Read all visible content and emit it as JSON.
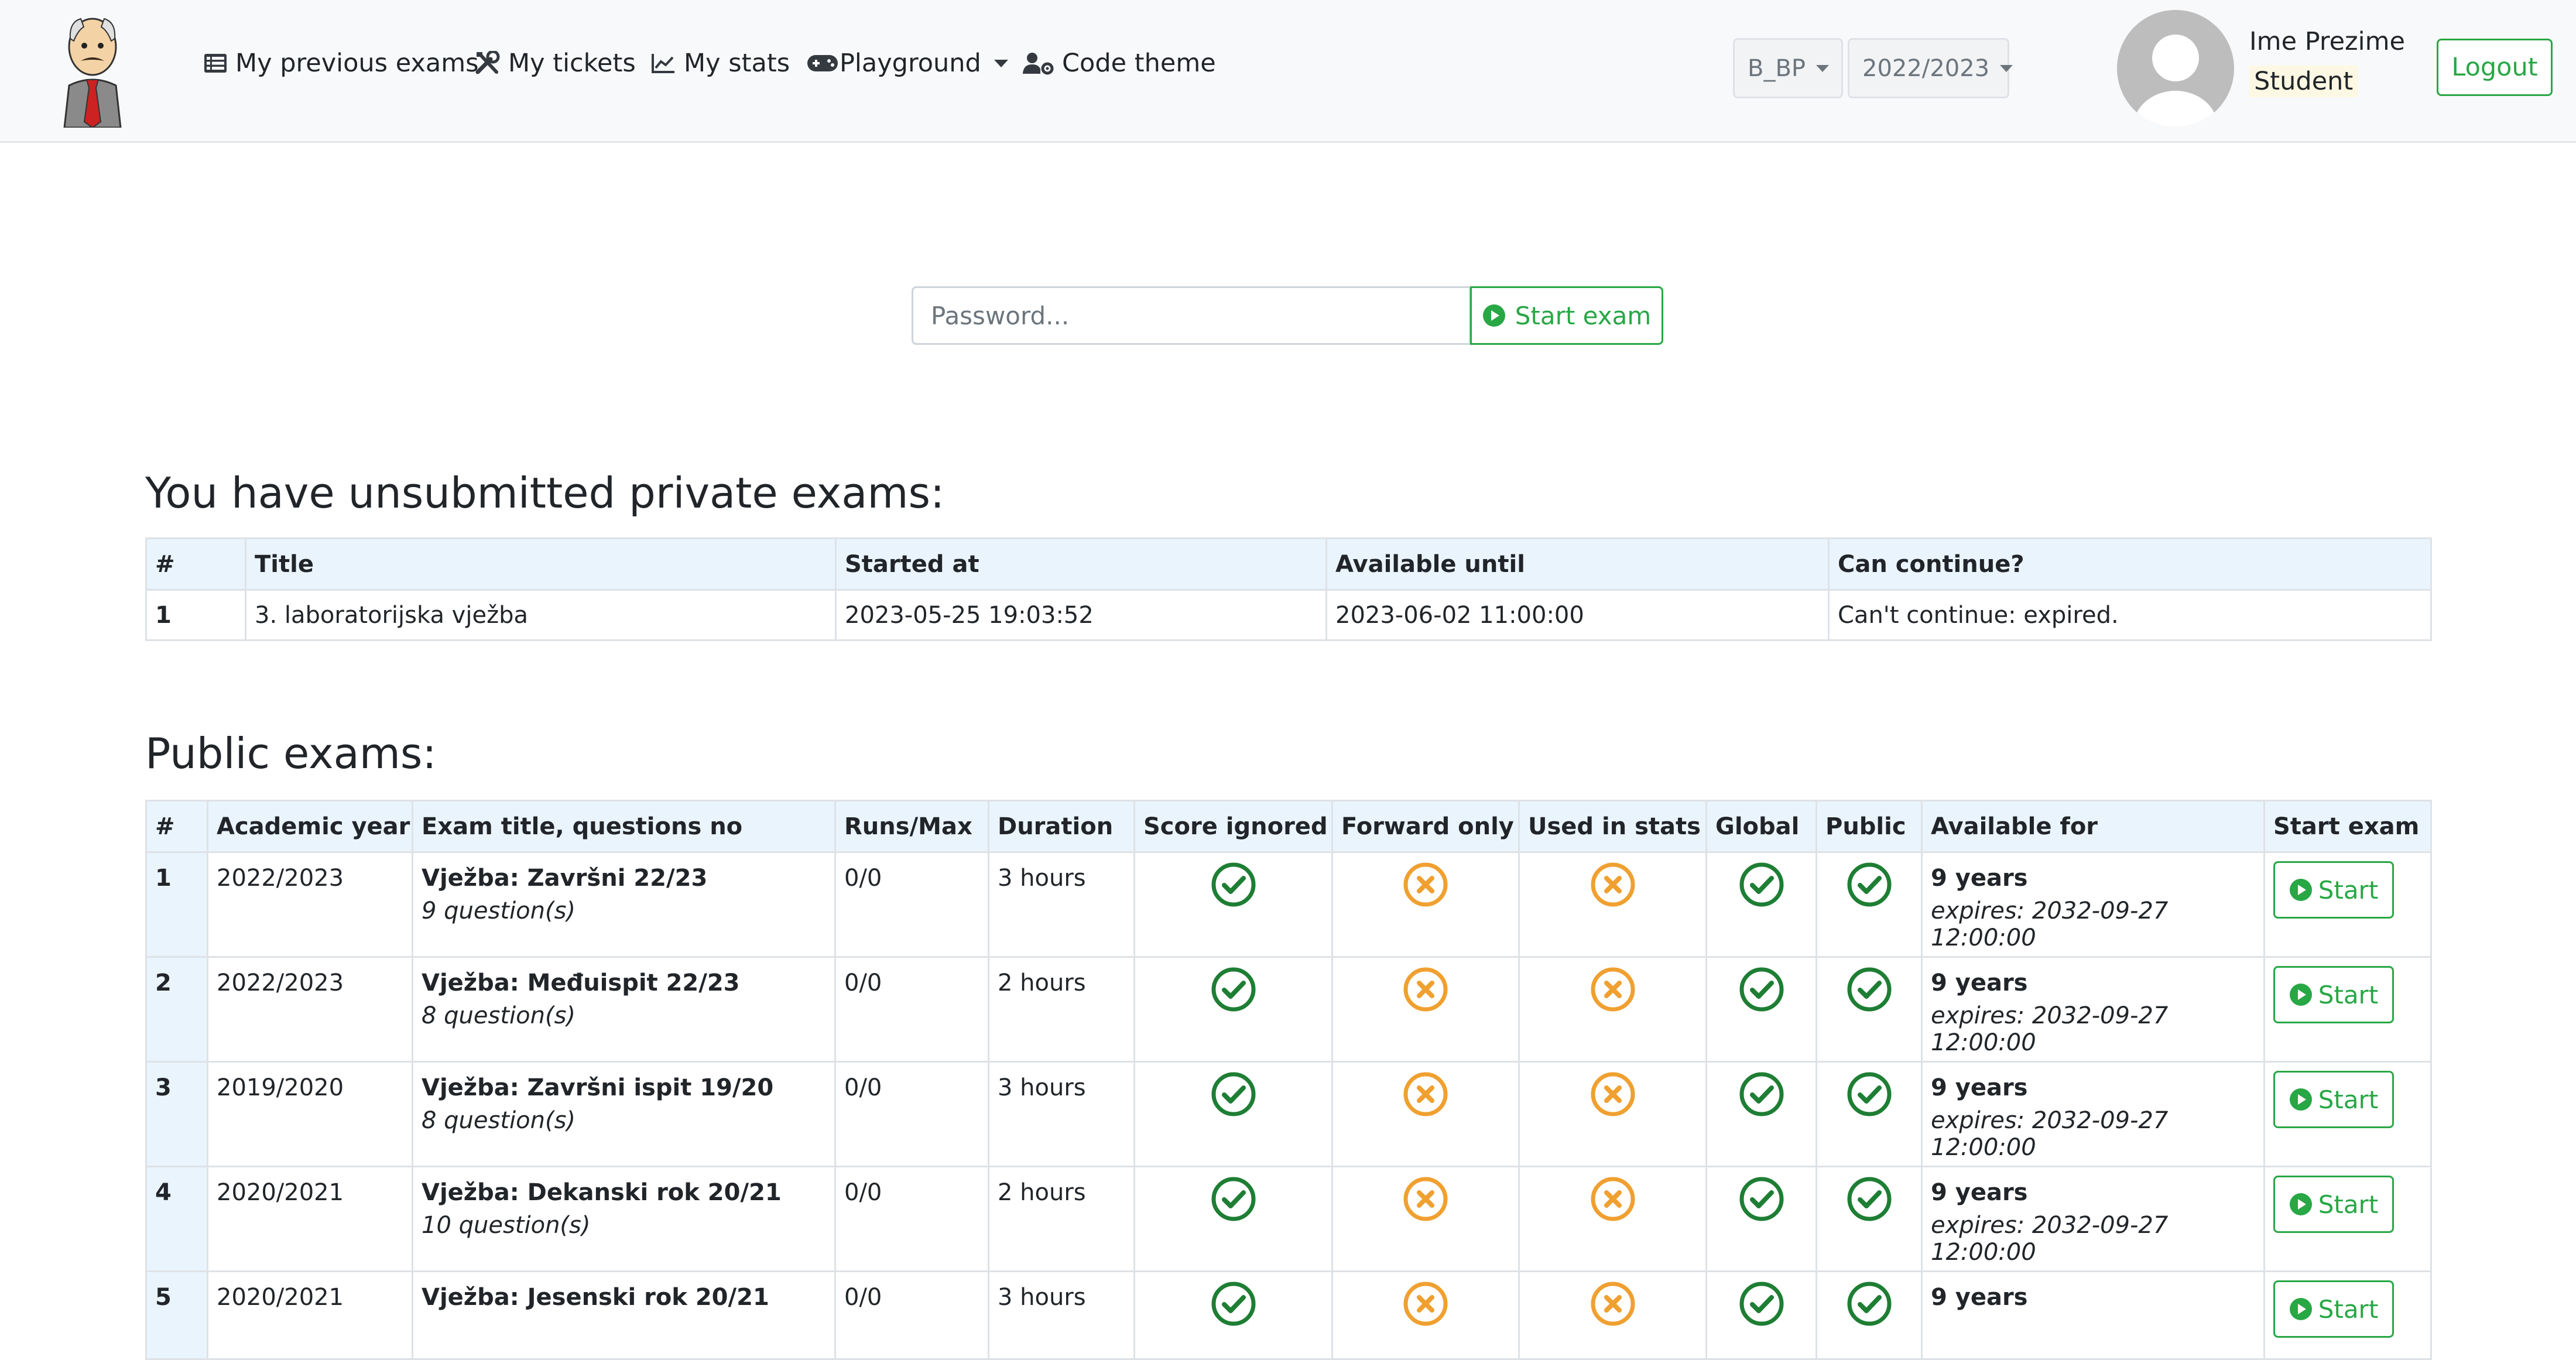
{
  "navbar": {
    "logo_icon": "professor-logo-icon",
    "items": [
      {
        "label": "My previous exams",
        "icon": "list-icon"
      },
      {
        "label": "My tickets",
        "icon": "tools-icon"
      },
      {
        "label": "My stats",
        "icon": "chart-line-icon"
      },
      {
        "label": "Playground",
        "icon": "gamepad-icon"
      },
      {
        "label": "Code theme",
        "icon": "user-cog-icon"
      }
    ],
    "course_select": "B_BP",
    "year_select": "2022/2023",
    "user": {
      "name": "Ime Prezime",
      "role": "Student"
    },
    "logout_label": "Logout"
  },
  "exam_form": {
    "password_placeholder": "Password...",
    "start_label": "Start exam"
  },
  "private_exams": {
    "title": "You have unsubmitted private exams:",
    "columns": [
      "#",
      "Title",
      "Started at",
      "Available until",
      "Can continue?"
    ],
    "rows": [
      [
        "1",
        "3. laboratorijska vježba",
        "2023-05-25 19:03:52",
        "2023-06-02 11:00:00",
        "Can't continue: expired."
      ]
    ]
  },
  "public_exams": {
    "title": "Public exams:",
    "columns": [
      "#",
      "Academic year",
      "Exam title, questions no",
      "Runs/Max",
      "Duration",
      "Score ignored",
      "Forward only",
      "Used in stats",
      "Global",
      "Public",
      "Available for",
      "Start exam"
    ],
    "rows": [
      {
        "num": "1",
        "year": "2022/2023",
        "title": "Vježba: Završni 22/23",
        "questions": "9 question(s)",
        "runs": "0/0",
        "duration": "3 hours",
        "available": "9 years",
        "expires": "expires: 2032-09-27 12:00:00",
        "start": "Start"
      },
      {
        "num": "2",
        "year": "2022/2023",
        "title": "Vježba: Međuispit 22/23",
        "questions": "8 question(s)",
        "runs": "0/0",
        "duration": "2 hours",
        "available": "9 years",
        "expires": "expires: 2032-09-27 12:00:00",
        "start": "Start"
      },
      {
        "num": "3",
        "year": "2019/2020",
        "title": "Vježba: Završni ispit 19/20",
        "questions": "8 question(s)",
        "runs": "0/0",
        "duration": "3 hours",
        "available": "9 years",
        "expires": "expires: 2032-09-27 12:00:00",
        "start": "Start"
      },
      {
        "num": "4",
        "year": "2020/2021",
        "title": "Vježba: Dekanski rok 20/21",
        "questions": "10 question(s)",
        "runs": "0/0",
        "duration": "2 hours",
        "available": "9 years",
        "expires": "expires: 2032-09-27 12:00:00",
        "start": "Start"
      },
      {
        "num": "5",
        "year": "2020/2021",
        "title": "Vježba: Jesenski rok 20/21",
        "questions": "",
        "runs": "0/0",
        "duration": "3 hours",
        "available": "9 years",
        "expires": "",
        "start": "Start"
      }
    ],
    "status_icons": {
      "yes": "check-circle-icon",
      "no": "times-circle-icon"
    },
    "colors": {
      "yes": "#1e7e34",
      "no": "#f0a030"
    }
  },
  "colors": {
    "success": "#28a745",
    "header_bg": "#eaf4fd",
    "navbar_bg": "#f8f9fa"
  }
}
